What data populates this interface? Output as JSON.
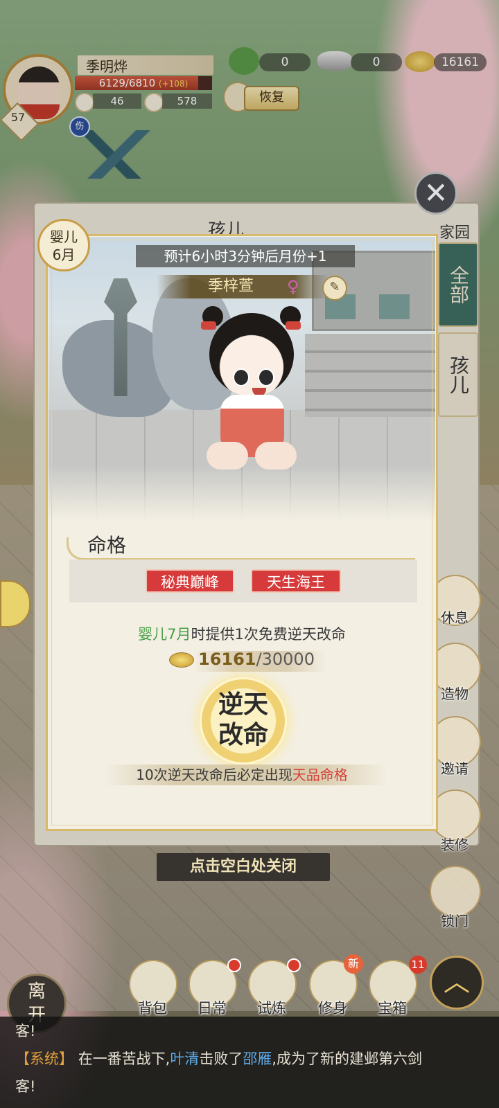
{
  "player": {
    "name": "季明烨",
    "level": "57",
    "hp_text": "6129/6810",
    "hp_extra": "(+108)",
    "hp_fraction": 0.9,
    "stat1": "46",
    "stat2": "578",
    "status_icon": "伤"
  },
  "resources": {
    "dragon": "0",
    "silver": "0",
    "gold": "16161",
    "recover_label": "恢复"
  },
  "back_panel": {
    "title": "孩儿",
    "home_label": "家园",
    "tabs": [
      "全部",
      "孩儿"
    ]
  },
  "right_toolbar": [
    "休息",
    "造物",
    "邀请",
    "装修",
    "锁门"
  ],
  "child": {
    "age_line1": "婴儿",
    "age_line2": "6月",
    "month_banner": "预计6小时3分钟后月份+1",
    "name": "季梓萱",
    "gender_symbol": "♀"
  },
  "fate": {
    "section_title": "命格",
    "traits": [
      "秘典巅峰",
      "天生海王"
    ],
    "free_prefix": "婴儿7月",
    "free_suffix": "时提供1次免费逆天改命",
    "cost_have": "16161",
    "cost_need": "/30000",
    "button_line1": "逆天",
    "button_line2": "改命",
    "guarantee_prefix": "10次逆天改命后必定出现",
    "guarantee_highlight": "天品命格"
  },
  "tap_close": "点击空白处关闭",
  "bottom_nav": {
    "leave": "离开",
    "items": [
      "背包",
      "日常",
      "试炼",
      "修身",
      "宝箱"
    ],
    "new_badge": "新",
    "chest_count": "11"
  },
  "chat": {
    "line0": "客!",
    "system_tag": "【系统】",
    "text1": "在一番苦战下,",
    "winner": "叶清",
    "text2": "击败了",
    "loser": "邵雁",
    "text3": ",成为了新的建邺第六剑",
    "line2": "客!"
  },
  "colors": {
    "accent_gold": "#d8b86b",
    "trait_red": "#d63a3a",
    "highlight_green": "#4aa04a",
    "highlight_red": "#d5423a",
    "tab_teal": "#3f6e64"
  }
}
